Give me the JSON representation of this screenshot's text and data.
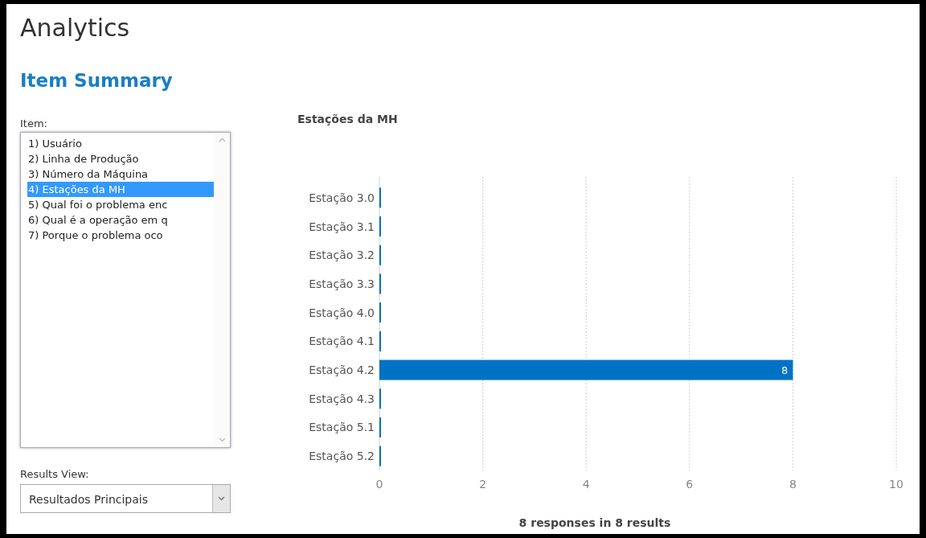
{
  "page": {
    "title": "Analytics",
    "subtitle": "Item Summary"
  },
  "item_list": {
    "label": "Item:",
    "items": [
      {
        "label": "1) Usuário",
        "selected": false
      },
      {
        "label": "2) Linha de Produção",
        "selected": false
      },
      {
        "label": "3) Número da Máquina",
        "selected": false
      },
      {
        "label": "4) Estações da MH",
        "selected": true
      },
      {
        "label": "5) Qual foi o problema enc",
        "selected": false
      },
      {
        "label": "6) Qual é a operação em q",
        "selected": false
      },
      {
        "label": "7) Porque o problema oco",
        "selected": false
      }
    ]
  },
  "results_view": {
    "label": "Results View:",
    "value": "Resultados Principais"
  },
  "chart": {
    "title": "Estações da MH",
    "chart_data": {
      "type": "bar",
      "orientation": "horizontal",
      "categories": [
        "Estação 3.0",
        "Estação 3.1",
        "Estação 3.2",
        "Estação 3.3",
        "Estação 4.0",
        "Estação 4.1",
        "Estação 4.2",
        "Estação 4.3",
        "Estação 5.1",
        "Estação 5.2"
      ],
      "series": [
        {
          "color": "#0072c6",
          "values": [
            0,
            0,
            0,
            0,
            0,
            0,
            8,
            0,
            0,
            0
          ]
        }
      ],
      "xlim": [
        0,
        10
      ],
      "xticks": [
        0,
        2,
        4,
        6,
        8,
        10
      ],
      "grid": true,
      "value_labels": [
        null,
        null,
        null,
        null,
        null,
        null,
        "8",
        null,
        null,
        null
      ]
    }
  },
  "summary": "8 responses in 8 results"
}
